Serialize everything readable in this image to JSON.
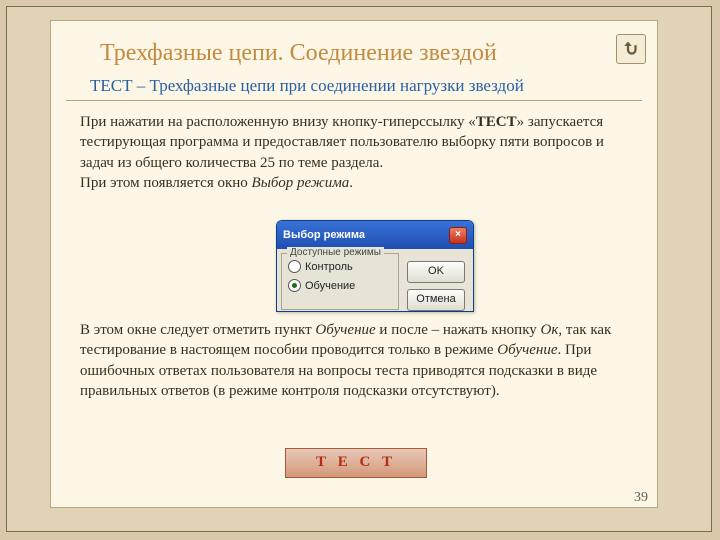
{
  "title": "Трехфазные цепи. Соединение звездой",
  "subtitle": "ТЕСТ – Трехфазные цепи при соединении нагрузки звездой",
  "para1_parts": [
    "При нажатии на расположенную внизу кнопку-гиперссылку «",
    "ТЕСТ",
    "» запускается тестирующая программа и предоставляет пользователю выборку пяти вопросов и задач из общего количества 25 по теме раздела.",
    "При этом появляется окно ",
    "Выбор режима",
    "."
  ],
  "para2_parts": [
    "В этом окне следует отметить пункт ",
    "Обучение",
    " и после – нажать кнопку ",
    "Ок",
    ", так как тестирование в настоящем пособии проводится только в режиме ",
    "Обучение",
    ". При ошибочных ответах пользователя на вопросы теста приводятся подсказки в виде правильных ответов (в режиме контроля подсказки отсутствуют)."
  ],
  "dialog": {
    "title": "Выбор режима",
    "group": "Доступные режимы",
    "opt1": "Контроль",
    "opt2": "Обучение",
    "ok": "OK",
    "cancel": "Отмена"
  },
  "test_button": "Т Е С Т",
  "page_number": "39"
}
